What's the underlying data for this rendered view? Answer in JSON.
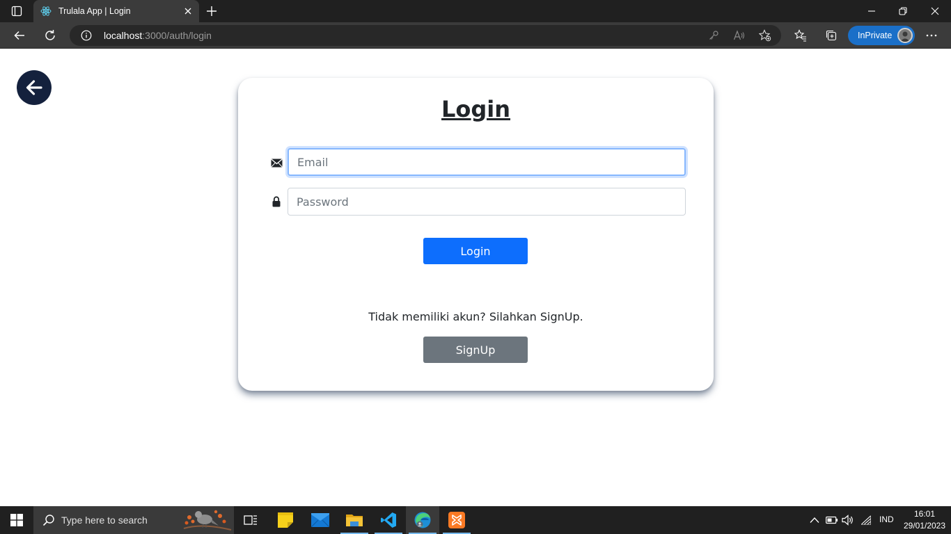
{
  "browser": {
    "tab_title": "Trulala App | Login",
    "url_host": "localhost",
    "url_path": ":3000/auth/login",
    "inprivate_label": "InPrivate"
  },
  "page": {
    "title": "Login",
    "email_placeholder": "Email",
    "password_placeholder": "Password",
    "login_button": "Login",
    "signup_prompt": "Tidak memiliki akun? Silahkan SignUp.",
    "signup_button": "SignUp"
  },
  "taskbar": {
    "search_placeholder": "Type here to search",
    "language": "IND",
    "time": "16:01",
    "date": "29/01/2023",
    "apps": [
      "task-view",
      "sticky-notes",
      "mail",
      "file-explorer",
      "vscode",
      "edge",
      "xampp"
    ]
  },
  "colors": {
    "primary": "#0d6efd",
    "secondary": "#6c757d",
    "back_button": "#14213d",
    "focus_ring": "#86b7fe"
  }
}
